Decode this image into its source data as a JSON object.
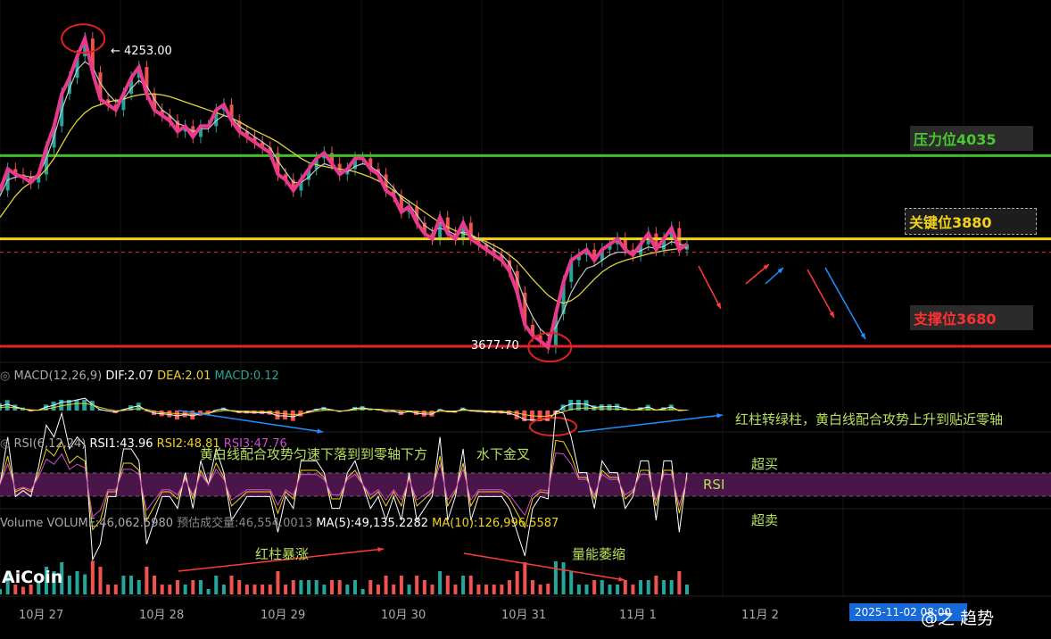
{
  "chart_data": {
    "type": "candlestick",
    "price_levels": {
      "resistance": {
        "label": "压力位4035",
        "value": 4035,
        "color": "#3fbf2a"
      },
      "key": {
        "label": "关键位3880",
        "value": 3880,
        "color": "#f2d21b"
      },
      "support": {
        "label": "支撑位3680",
        "value": 3680,
        "color": "#e0252b"
      }
    },
    "price_range": [
      3660,
      4275
    ],
    "high_marker": "← 4253.00",
    "low_marker": "3677.70",
    "current_dashed_level": 3855,
    "close_series": [
      3970,
      4010,
      4000,
      3995,
      3985,
      4000,
      4050,
      4090,
      4150,
      4180,
      4220,
      4253,
      4190,
      4140,
      4130,
      4120,
      4150,
      4180,
      4200,
      4150,
      4120,
      4110,
      4100,
      4080,
      4090,
      4070,
      4090,
      4090,
      4120,
      4130,
      4100,
      4080,
      4070,
      4060,
      4050,
      4040,
      4000,
      3990,
      3970,
      3990,
      4010,
      4030,
      4040,
      4020,
      4000,
      4010,
      4030,
      4030,
      4010,
      4000,
      3970,
      3960,
      3930,
      3940,
      3910,
      3890,
      3880,
      3920,
      3890,
      3880,
      3910,
      3880,
      3870,
      3860,
      3850,
      3840,
      3820,
      3780,
      3720,
      3700,
      3690,
      3678,
      3740,
      3800,
      3840,
      3850,
      3860,
      3840,
      3860,
      3870,
      3880,
      3860,
      3850,
      3870,
      3890,
      3860,
      3880,
      3900,
      3860,
      3870
    ],
    "ma_short_series": [
      3960,
      3990,
      3995,
      3998,
      3995,
      3998,
      4030,
      4070,
      4120,
      4160,
      4195,
      4210,
      4200,
      4170,
      4150,
      4135,
      4140,
      4160,
      4175,
      4165,
      4140,
      4120,
      4110,
      4095,
      4090,
      4080,
      4085,
      4085,
      4100,
      4110,
      4105,
      4090,
      4080,
      4070,
      4060,
      4050,
      4025,
      4005,
      3985,
      3985,
      3995,
      4010,
      4020,
      4015,
      4005,
      4005,
      4015,
      4020,
      4015,
      4005,
      3990,
      3975,
      3955,
      3945,
      3925,
      3905,
      3895,
      3900,
      3895,
      3888,
      3893,
      3888,
      3880,
      3870,
      3860,
      3850,
      3835,
      3805,
      3765,
      3735,
      3712,
      3700,
      3715,
      3745,
      3780,
      3805,
      3825,
      3830,
      3840,
      3850,
      3855,
      3855,
      3853,
      3858,
      3865,
      3862,
      3866,
      3875,
      3870,
      3868
    ],
    "ma_long_series": [
      3920,
      3940,
      3960,
      3975,
      3985,
      3995,
      4010,
      4030,
      4055,
      4080,
      4100,
      4115,
      4125,
      4130,
      4135,
      4138,
      4140,
      4145,
      4148,
      4150,
      4150,
      4148,
      4145,
      4140,
      4135,
      4130,
      4125,
      4120,
      4115,
      4110,
      4105,
      4098,
      4090,
      4082,
      4075,
      4068,
      4060,
      4050,
      4040,
      4030,
      4022,
      4018,
      4015,
      4012,
      4010,
      4008,
      4005,
      4000,
      3995,
      3988,
      3980,
      3970,
      3960,
      3950,
      3940,
      3930,
      3920,
      3910,
      3902,
      3895,
      3890,
      3885,
      3880,
      3875,
      3868,
      3860,
      3850,
      3838,
      3822,
      3805,
      3790,
      3775,
      3765,
      3760,
      3765,
      3775,
      3790,
      3805,
      3818,
      3828,
      3835,
      3840,
      3844,
      3848,
      3852,
      3855,
      3858,
      3860,
      3862,
      3864
    ],
    "x_tick_labels": [
      "10月 27",
      "10月 28",
      "10月 29",
      "10月 30",
      "10月 31",
      "11月 1",
      "11月 2"
    ],
    "time_badge": "2025-11-02 08:00",
    "macd_header": {
      "name": "MACD(12,26,9)",
      "dif": "DIF:2.07",
      "dea": "DEA:2.01",
      "macd": "MACD:0.12"
    },
    "rsi_header": {
      "name": "RSI(6,12,24)",
      "rsi1": "RSI1:43.96",
      "rsi2": "RSI2:48.81",
      "rsi3": "RSI3:47.76"
    },
    "rsi_band_label": "RSI",
    "volume_header": {
      "vol": "Volume  VOLUME:46,062.5980",
      "est": "预估成交量:46,554.0013",
      "ma5": "MA(5):49,135.2282",
      "ma10": "MA(10):126,996.5587"
    },
    "annotations": {
      "macd_down": "黄白线配合攻势匀速下落到到零轴下方",
      "golden_cross": "水下金叉",
      "macd_up": "红柱转绿柱，黄白线配合攻势上升到贴近零轴",
      "overbought": "超买",
      "oversold": "超卖",
      "vol_surge": "红柱暴涨",
      "vol_shrink": "量能萎缩"
    }
  },
  "branding": {
    "logo": "AiCoin",
    "watermark": "@之 趋势"
  },
  "colors": {
    "bg": "#000000",
    "price_line": "#e8398f",
    "ma_short": "#c8c8c8",
    "ma_long": "#e6d23a",
    "up": "#26a69a",
    "down": "#ef5350",
    "rsi_band": "#4a1548",
    "arrow_blue": "#1e90ff",
    "arrow_red": "#ff3b3b"
  }
}
